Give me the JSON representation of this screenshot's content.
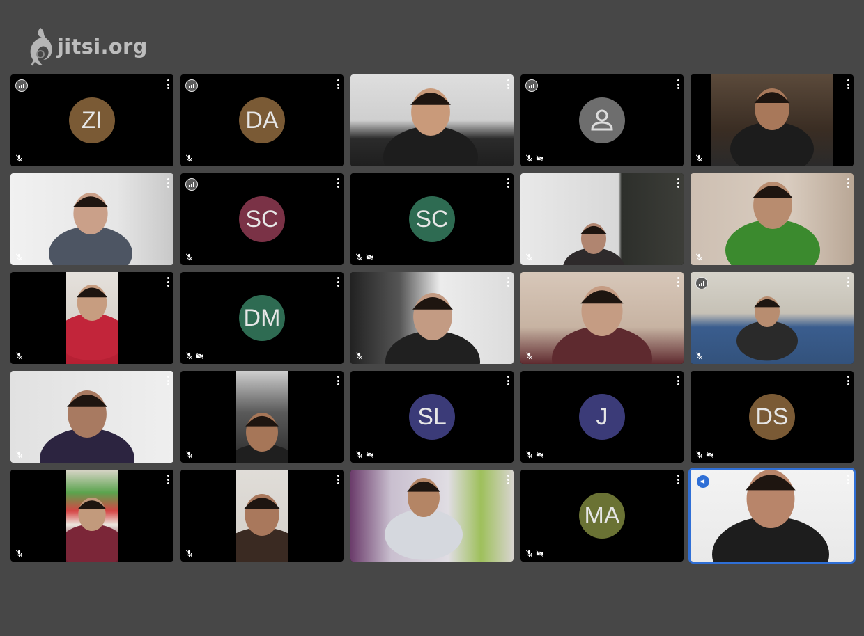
{
  "app": {
    "logo_text": "jitsi.org"
  },
  "colors": {
    "background": "#474747",
    "tile": "#000000",
    "active_border": "#2f6fd6",
    "avatar_text": "#e6e6e6"
  },
  "participants": [
    {
      "type": "avatar",
      "initials": "ZI",
      "avatar_color": "#7a5a35",
      "connection_icon": true,
      "audio_muted": true,
      "video_muted": false
    },
    {
      "type": "avatar",
      "initials": "DA",
      "avatar_color": "#7a5a35",
      "connection_icon": true,
      "audio_muted": true,
      "video_muted": false
    },
    {
      "type": "video",
      "description": "smiling boy with headphones",
      "audio_muted": false,
      "video_muted": false
    },
    {
      "type": "avatar",
      "initials": "",
      "placeholder_icon": "user-icon",
      "avatar_color": "#6e6e6e",
      "connection_icon": true,
      "audio_muted": true,
      "video_muted": true
    },
    {
      "type": "video",
      "description": "boy with earphones",
      "audio_muted": true,
      "video_muted": false
    },
    {
      "type": "video",
      "description": "girl with hand near chin",
      "audio_muted": true,
      "video_muted": false
    },
    {
      "type": "avatar",
      "initials": "SC",
      "avatar_color": "#7a3246",
      "connection_icon": true,
      "audio_muted": true,
      "video_muted": false
    },
    {
      "type": "avatar",
      "initials": "SC",
      "avatar_color": "#2e6b52",
      "connection_icon": false,
      "audio_muted": true,
      "video_muted": true
    },
    {
      "type": "video",
      "description": "girl in room with framed picture",
      "audio_muted": true,
      "video_muted": false
    },
    {
      "type": "video",
      "description": "boy in green shirt making hand sign",
      "audio_muted": true,
      "video_muted": false
    },
    {
      "type": "video",
      "description": "girl with earphones, red shirt",
      "audio_muted": true,
      "video_muted": false
    },
    {
      "type": "avatar",
      "initials": "DM",
      "avatar_color": "#2e6b52",
      "connection_icon": false,
      "audio_muted": true,
      "video_muted": true
    },
    {
      "type": "video",
      "description": "girl with curly hair resting on hand",
      "audio_muted": true,
      "video_muted": false
    },
    {
      "type": "video",
      "description": "girl smiling with long hair",
      "audio_muted": true,
      "video_muted": false
    },
    {
      "type": "video",
      "description": "boy on blue sofa",
      "connection_icon": true,
      "audio_muted": true,
      "video_muted": false
    },
    {
      "type": "video",
      "description": "boy with clasped hands",
      "audio_muted": true,
      "video_muted": false
    },
    {
      "type": "video",
      "description": "boy with red cap",
      "audio_muted": true,
      "video_muted": false
    },
    {
      "type": "avatar",
      "initials": "SL",
      "avatar_color": "#3b3b78",
      "connection_icon": false,
      "audio_muted": true,
      "video_muted": true
    },
    {
      "type": "avatar",
      "initials": "J",
      "avatar_color": "#3b3b78",
      "connection_icon": false,
      "audio_muted": true,
      "video_muted": true
    },
    {
      "type": "avatar",
      "initials": "DS",
      "avatar_color": "#7a5a35",
      "connection_icon": false,
      "audio_muted": true,
      "video_muted": true
    },
    {
      "type": "video",
      "description": "boy with glasses, red shirt",
      "audio_muted": true,
      "video_muted": false
    },
    {
      "type": "video",
      "description": "girl resting chin on hand",
      "audio_muted": true,
      "video_muted": false
    },
    {
      "type": "video",
      "description": "boy with headset giving thumbs up",
      "audio_muted": false,
      "video_muted": false
    },
    {
      "type": "avatar",
      "initials": "MA",
      "avatar_color": "#6a7234",
      "connection_icon": false,
      "audio_muted": true,
      "video_muted": true
    },
    {
      "type": "video",
      "description": "adult man, active speaker",
      "active_speaker": true,
      "audio_muted": false,
      "video_muted": false
    }
  ]
}
